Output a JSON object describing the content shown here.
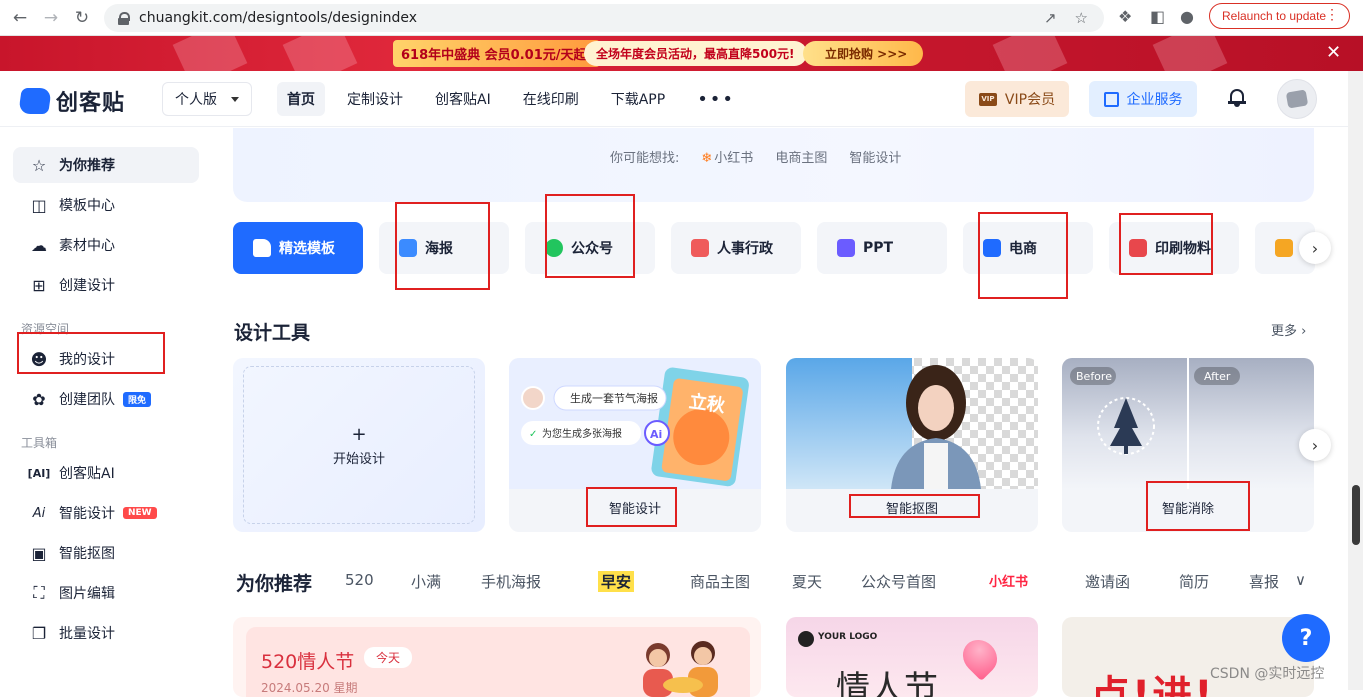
{
  "browser": {
    "url": "chuangkit.com/designtools/designindex",
    "relaunch_label": "Relaunch to update"
  },
  "promo": {
    "badge_text": "618年中盛典 会员0.01元/天起!",
    "activity_text": "全场年度会员活动，最高直降500元!",
    "cta_text": "立即抢购 >>>"
  },
  "header": {
    "logo_text": "创客贴",
    "edition": "个人版",
    "nav": [
      "首页",
      "定制设计",
      "创客贴AI",
      "在线印刷",
      "下载APP"
    ],
    "vip_label": "VIP会员",
    "vip_badge": "VIP",
    "enterprise_label": "企业服务"
  },
  "sidebar": {
    "items_top": [
      "为你推荐",
      "模板中心",
      "素材中心",
      "创建设计"
    ],
    "section_resources": "资源空间",
    "items_resources": [
      "我的设计",
      "创建团队"
    ],
    "team_badge": "限免",
    "section_tools": "工具箱",
    "items_tools": [
      "创客贴AI",
      "智能设计",
      "智能抠图",
      "图片编辑",
      "批量设计"
    ],
    "new_badge": "NEW"
  },
  "search": {
    "prompt": "你可能想找:",
    "suggestions": [
      "小红书",
      "电商主图",
      "智能设计"
    ]
  },
  "categories": [
    "精选模板",
    "海报",
    "公众号",
    "人事行政",
    "PPT",
    "电商",
    "印刷物料"
  ],
  "design_tools": {
    "title": "设计工具",
    "more": "更多",
    "start": "开始设计",
    "cards": [
      "智能设计",
      "智能抠图",
      "智能消除"
    ],
    "bubble1": "生成一套节气海报",
    "bubble2": "为您生成多张海报",
    "poster_text": "立秋",
    "before": "Before",
    "after": "After"
  },
  "recommend": {
    "title": "为你推荐",
    "tabs": [
      "520",
      "小满",
      "手机海报",
      "早安",
      "商品主图",
      "夏天",
      "公众号首图",
      "小红书",
      "邀请函",
      "简历",
      "喜报"
    ],
    "card1_title": "520情人节",
    "card1_tag": "今天",
    "card1_date": "2024.05.20 星期",
    "card2_logo": "YOUR LOGO",
    "card2_title": "情人节",
    "card3_text": "点!进!"
  },
  "help_label": "?",
  "watermark": "CSDN @实时远控",
  "colors": {
    "brand_blue": "#1f6bff",
    "annotation_red": "#e02020",
    "promo_red": "#c8152b"
  }
}
